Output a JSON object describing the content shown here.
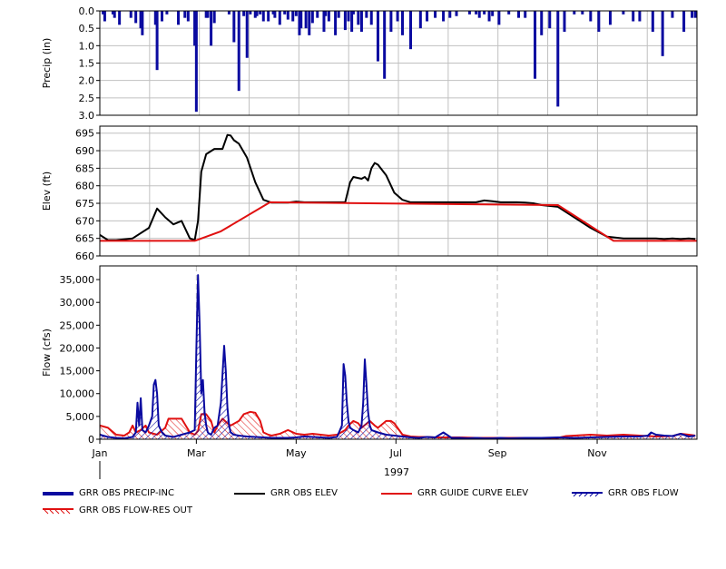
{
  "chart_data": [
    {
      "type": "bar",
      "ylabel": "Precip (in)",
      "ylim": [
        3.0,
        0.0
      ],
      "y_inverted": true,
      "yticks": [
        "0.0",
        "0.5",
        "1.0",
        "1.5",
        "2.0",
        "2.5",
        "3.0"
      ],
      "grid": true,
      "color": "#0a0aa0",
      "series": [
        {
          "name": "GRR OBS PRECIP-INC",
          "x_day": [
            2,
            3,
            8,
            9,
            12,
            19,
            22,
            25,
            26,
            34,
            35,
            38,
            41,
            48,
            52,
            54,
            58,
            59,
            65,
            66,
            68,
            70,
            79,
            82,
            85,
            88,
            90,
            92,
            95,
            96,
            98,
            100,
            103,
            106,
            107,
            110,
            113,
            115,
            118,
            120,
            122,
            123,
            126,
            128,
            130,
            133,
            137,
            138,
            140,
            144,
            146,
            150,
            152,
            154,
            155,
            158,
            160,
            163,
            166,
            170,
            174,
            178,
            182,
            185,
            190,
            196,
            200,
            205,
            210,
            214,
            218,
            226,
            230,
            232,
            235,
            238,
            240,
            244,
            250,
            256,
            260,
            266,
            270,
            275,
            280,
            284,
            290,
            295,
            300,
            305,
            312,
            320,
            326,
            330,
            338,
            344,
            350,
            357,
            362,
            364
          ],
          "values": [
            0.1,
            0.3,
            0.1,
            0.2,
            0.4,
            0.2,
            0.35,
            0.5,
            0.7,
            0.4,
            1.7,
            0.3,
            0.1,
            0.4,
            0.2,
            0.3,
            1.0,
            2.9,
            0.2,
            0.2,
            1.0,
            0.35,
            0.1,
            0.9,
            2.3,
            0.15,
            1.35,
            0.1,
            0.2,
            0.15,
            0.1,
            0.3,
            0.3,
            0.1,
            0.2,
            0.4,
            0.1,
            0.25,
            0.3,
            0.15,
            0.7,
            0.5,
            0.5,
            0.7,
            0.35,
            0.2,
            0.6,
            0.15,
            0.3,
            0.7,
            0.2,
            0.55,
            0.3,
            0.6,
            0.1,
            0.4,
            0.6,
            0.2,
            0.4,
            1.45,
            1.95,
            0.6,
            0.3,
            0.7,
            1.1,
            0.5,
            0.3,
            0.2,
            0.3,
            0.2,
            0.15,
            0.1,
            0.1,
            0.2,
            0.1,
            0.3,
            0.15,
            0.4,
            0.1,
            0.2,
            0.2,
            1.95,
            0.7,
            0.5,
            2.75,
            0.6,
            0.1,
            0.1,
            0.3,
            0.6,
            0.4,
            0.1,
            0.3,
            0.3,
            0.6,
            1.3,
            0.2,
            0.6,
            0.2,
            0.2
          ]
        }
      ]
    },
    {
      "type": "line",
      "ylabel": "Elev (ft)",
      "ylim": [
        660,
        697
      ],
      "yticks": [
        "660",
        "665",
        "670",
        "675",
        "680",
        "685",
        "690",
        "695"
      ],
      "grid": true,
      "series": [
        {
          "name": "GRR OBS ELEV",
          "color": "#000000",
          "x_day": [
            0,
            5,
            10,
            20,
            30,
            35,
            40,
            45,
            50,
            55,
            58,
            60,
            62,
            65,
            70,
            75,
            78,
            80,
            82,
            85,
            90,
            95,
            100,
            105,
            108,
            112,
            115,
            120,
            125,
            130,
            135,
            140,
            145,
            150,
            153,
            155,
            160,
            162,
            164,
            166,
            168,
            170,
            175,
            180,
            185,
            190,
            195,
            200,
            205,
            210,
            215,
            220,
            225,
            230,
            235,
            240,
            245,
            250,
            255,
            260,
            265,
            270,
            280,
            290,
            300,
            310,
            320,
            330,
            340,
            345,
            350,
            355,
            360,
            364
          ],
          "values": [
            666,
            664.5,
            664.5,
            665,
            668,
            673.5,
            671,
            669,
            670,
            665,
            664.5,
            670,
            684,
            689,
            690.5,
            690.5,
            694.5,
            694.3,
            693,
            692,
            688,
            681,
            676,
            675.2,
            675.2,
            675.2,
            675.2,
            675.5,
            675.3,
            675.3,
            675.3,
            675.3,
            675.3,
            675.3,
            681,
            682.5,
            682,
            682.5,
            681.5,
            685,
            686.5,
            686,
            683,
            678,
            676,
            675.3,
            675.3,
            675.3,
            675.3,
            675.3,
            675.3,
            675.3,
            675.3,
            675.3,
            675.8,
            675.6,
            675.3,
            675.3,
            675.3,
            675.2,
            675,
            674.5,
            674,
            671,
            668,
            665.5,
            665,
            665,
            665,
            664.8,
            665,
            664.8,
            665,
            664.8
          ]
        },
        {
          "name": "GRR GUIDE CURVE ELEV",
          "color": "#e01010",
          "x_day": [
            0,
            58,
            74,
            104,
            280,
            314,
            365
          ],
          "values": [
            664.3,
            664.3,
            667,
            675.3,
            674.5,
            664.3,
            664.3
          ]
        }
      ]
    },
    {
      "type": "area",
      "ylabel": "Flow (cfs)",
      "ylim": [
        0,
        38000
      ],
      "yticks": [
        "0",
        "5,000",
        "10,000",
        "15,000",
        "20,000",
        "25,000",
        "30,000",
        "35,000"
      ],
      "grid": true,
      "series": [
        {
          "name": "GRR OBS FLOW",
          "color": "#0a0aa0",
          "x_day": [
            0,
            5,
            10,
            15,
            20,
            22,
            23,
            24,
            25,
            26,
            28,
            30,
            32,
            33,
            34,
            35,
            36,
            38,
            40,
            45,
            48,
            50,
            55,
            58,
            59,
            60,
            61,
            62,
            63,
            64,
            65,
            66,
            67,
            68,
            70,
            72,
            74,
            76,
            77,
            78,
            79,
            80,
            82,
            85,
            90,
            95,
            100,
            105,
            110,
            115,
            120,
            125,
            130,
            135,
            140,
            145,
            148,
            149,
            150,
            151,
            152,
            153,
            155,
            158,
            160,
            161,
            162,
            163,
            164,
            165,
            166,
            170,
            175,
            180,
            185,
            190,
            195,
            200,
            205,
            210,
            215,
            220,
            225,
            230,
            235,
            240,
            245,
            250,
            260,
            270,
            280,
            290,
            300,
            310,
            320,
            330,
            335,
            337,
            340,
            345,
            350,
            355,
            360,
            364
          ],
          "values": [
            1000,
            500,
            300,
            200,
            500,
            1500,
            8000,
            3000,
            9000,
            2000,
            1500,
            3000,
            5000,
            12000,
            13000,
            10000,
            3000,
            1500,
            800,
            500,
            800,
            1000,
            1500,
            2000,
            20000,
            36000,
            25000,
            10000,
            13000,
            6000,
            3000,
            1500,
            1200,
            1000,
            2500,
            3000,
            8000,
            20500,
            15000,
            7000,
            3000,
            1500,
            1000,
            800,
            600,
            500,
            400,
            300,
            300,
            300,
            400,
            600,
            500,
            400,
            300,
            500,
            3000,
            16500,
            14000,
            8000,
            4000,
            2500,
            2000,
            1500,
            3000,
            8000,
            17500,
            12000,
            6000,
            3000,
            2000,
            1500,
            1000,
            800,
            600,
            400,
            300,
            500,
            400,
            1500,
            300,
            300,
            200,
            300,
            200,
            200,
            300,
            200,
            300,
            300,
            400,
            300,
            400,
            500,
            600,
            600,
            800,
            1500,
            1000,
            800,
            700,
            1200,
            600,
            800
          ]
        },
        {
          "name": "GRR OBS FLOW-RES OUT",
          "color": "#e01010",
          "x_day": [
            0,
            5,
            10,
            15,
            18,
            20,
            22,
            25,
            28,
            30,
            35,
            40,
            42,
            45,
            50,
            55,
            58,
            60,
            62,
            65,
            68,
            70,
            72,
            75,
            78,
            80,
            85,
            88,
            92,
            95,
            98,
            100,
            103,
            105,
            110,
            115,
            120,
            125,
            130,
            135,
            140,
            145,
            150,
            152,
            155,
            158,
            160,
            165,
            168,
            170,
            175,
            178,
            180,
            185,
            190,
            195,
            200,
            205,
            210,
            215,
            220,
            230,
            240,
            250,
            260,
            270,
            280,
            285,
            290,
            300,
            310,
            320,
            330,
            340,
            350,
            355,
            360,
            364
          ],
          "values": [
            3000,
            2500,
            1000,
            800,
            1500,
            3000,
            1500,
            2000,
            3000,
            1500,
            1000,
            2500,
            4500,
            4500,
            4500,
            1500,
            1000,
            1800,
            5500,
            5500,
            4000,
            1500,
            3000,
            4500,
            3500,
            3000,
            4000,
            5500,
            6000,
            5800,
            4000,
            1500,
            1000,
            800,
            1200,
            2000,
            1200,
            1000,
            1200,
            1000,
            800,
            1000,
            2000,
            3000,
            4000,
            3500,
            2500,
            4000,
            3000,
            2500,
            4000,
            4000,
            3500,
            1000,
            600,
            500,
            500,
            400,
            400,
            400,
            400,
            300,
            300,
            300,
            300,
            300,
            300,
            700,
            800,
            1000,
            800,
            1000,
            800,
            600,
            700,
            1200,
            1000,
            800
          ]
        }
      ],
      "xticks": [
        "Jan",
        "Mar",
        "May",
        "Jul",
        "Sep",
        "Nov"
      ],
      "xtick_days": [
        0,
        59,
        120,
        181,
        243,
        304
      ],
      "year_label": "1997"
    }
  ],
  "legend": {
    "precip": "GRR OBS PRECIP-INC",
    "elev": "GRR OBS ELEV",
    "guide": "GRR GUIDE CURVE ELEV",
    "flow": "GRR OBS FLOW",
    "resout": "GRR OBS FLOW-RES OUT"
  }
}
